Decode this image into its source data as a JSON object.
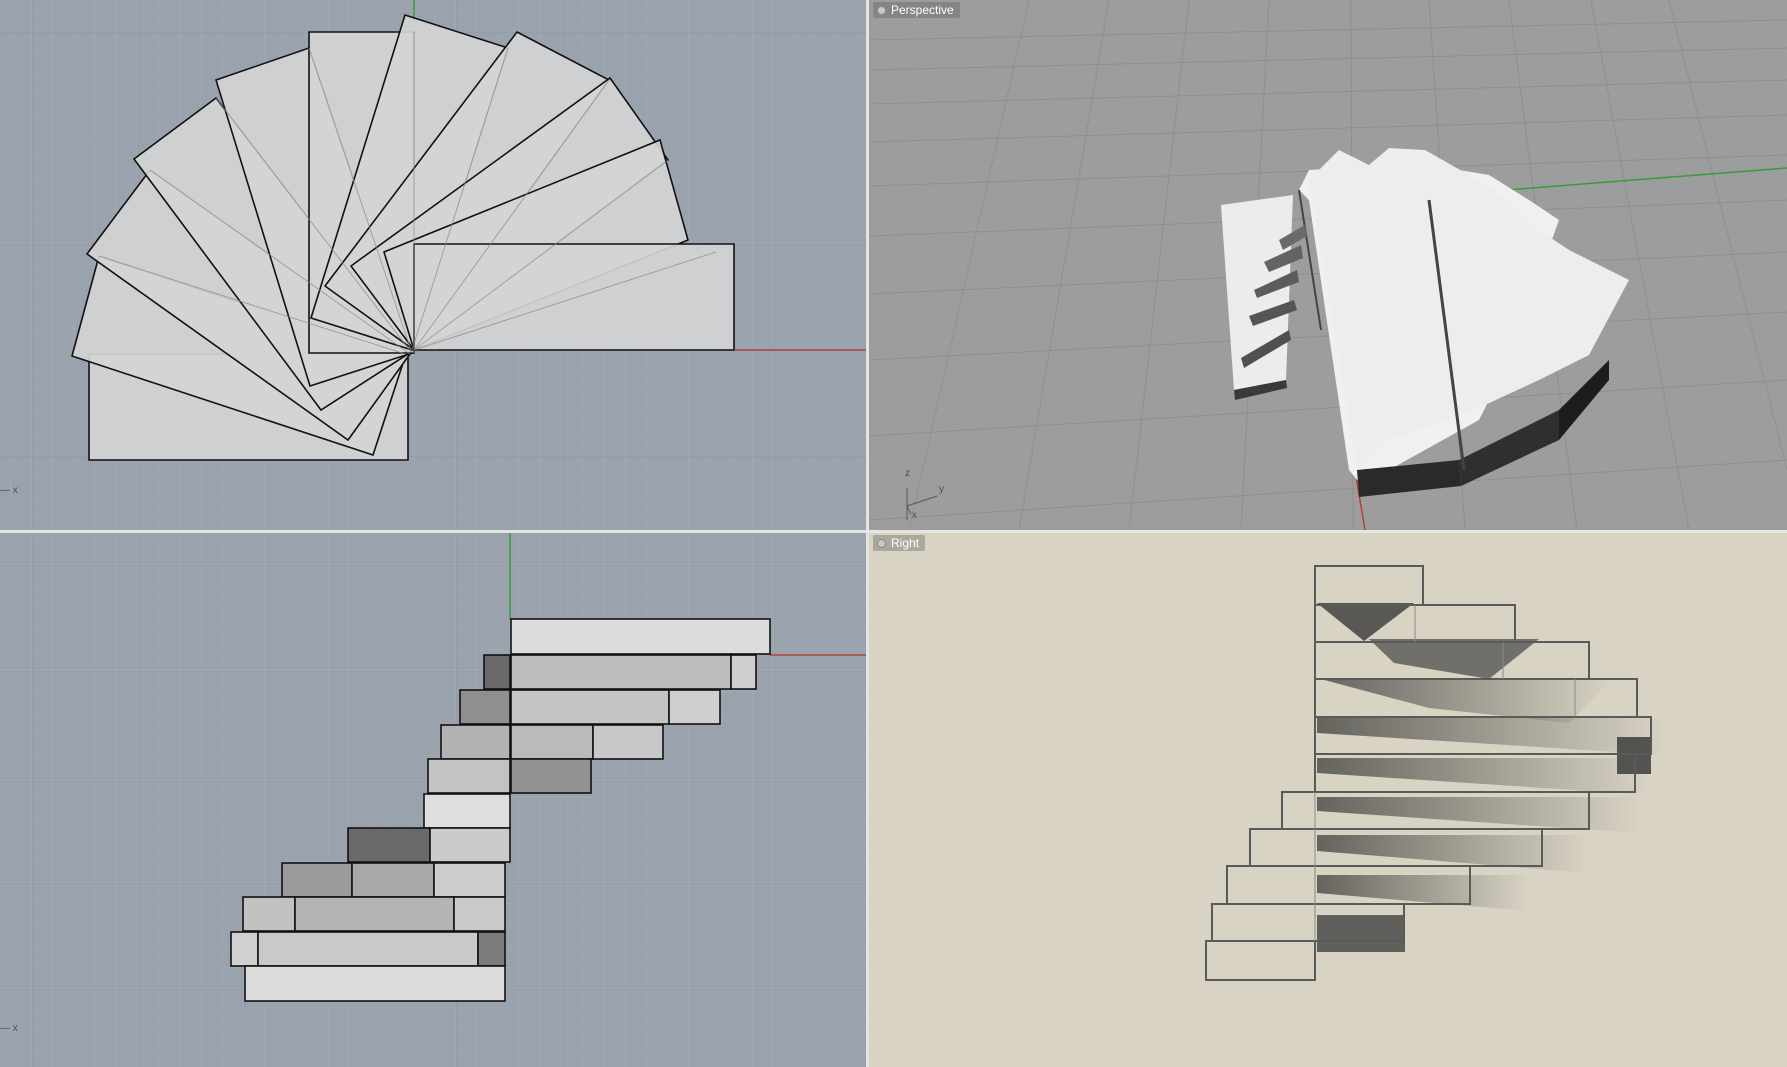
{
  "viewports": [
    {
      "id": "top",
      "label": ""
    },
    {
      "id": "perspective",
      "label": "Perspective"
    },
    {
      "id": "front",
      "label": ""
    },
    {
      "id": "right",
      "label": "Right"
    }
  ],
  "axes": {
    "x": "x",
    "y": "y",
    "z": "z"
  },
  "colors": {
    "grid_bg": "#9aa3ae",
    "grid_minor": "#a3abb5",
    "grid_major": "#8c95a0",
    "axis_x": "#b5413a",
    "axis_y": "#3a9b3a",
    "persp_bg": "#9f9f9f",
    "paper_bg": "#d9d4c4",
    "part_fill": "#d6d6d6",
    "part_stroke": "#111111"
  },
  "icons": [
    "viewport-menu-icon",
    "axis-triad-icon"
  ]
}
